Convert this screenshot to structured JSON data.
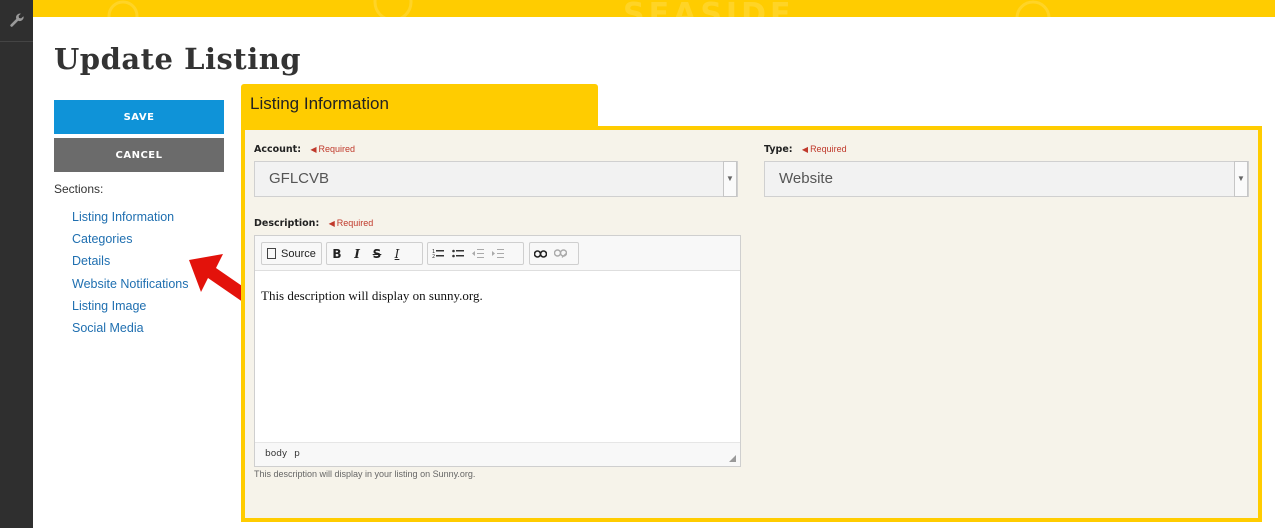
{
  "banner": {
    "watermark": "SEASIDE"
  },
  "page_title": "Update Listing",
  "actions": {
    "save_label": "SAVE",
    "cancel_label": "CANCEL"
  },
  "sections": {
    "label": "Sections:",
    "items": [
      "Listing Information",
      "Categories",
      "Details",
      "Website Notifications",
      "Listing Image",
      "Social Media"
    ]
  },
  "tab": {
    "label": "Listing Information"
  },
  "form": {
    "account": {
      "label": "Account:",
      "required": "Required",
      "value": "GFLCVB"
    },
    "type": {
      "label": "Type:",
      "required": "Required",
      "value": "Website"
    },
    "description": {
      "label": "Description:",
      "required": "Required",
      "content": "This description will display on sunny.org.",
      "helper": "This description will display in your listing on Sunny.org."
    }
  },
  "editor": {
    "source_label": "Source",
    "path": [
      "body",
      "p"
    ],
    "icons": [
      "source-icon",
      "bold-icon",
      "italic-icon",
      "strikethrough-icon",
      "remove-format-icon",
      "numbered-list-icon",
      "bulleted-list-icon",
      "decrease-indent-icon",
      "increase-indent-icon",
      "link-icon",
      "unlink-icon"
    ]
  },
  "colors": {
    "accent": "#ffcc00",
    "save": "#0f93d8",
    "cancel": "#6b6b6b",
    "link": "#1f6fb0",
    "required": "#c0392b",
    "arrow": "#e3120b"
  }
}
